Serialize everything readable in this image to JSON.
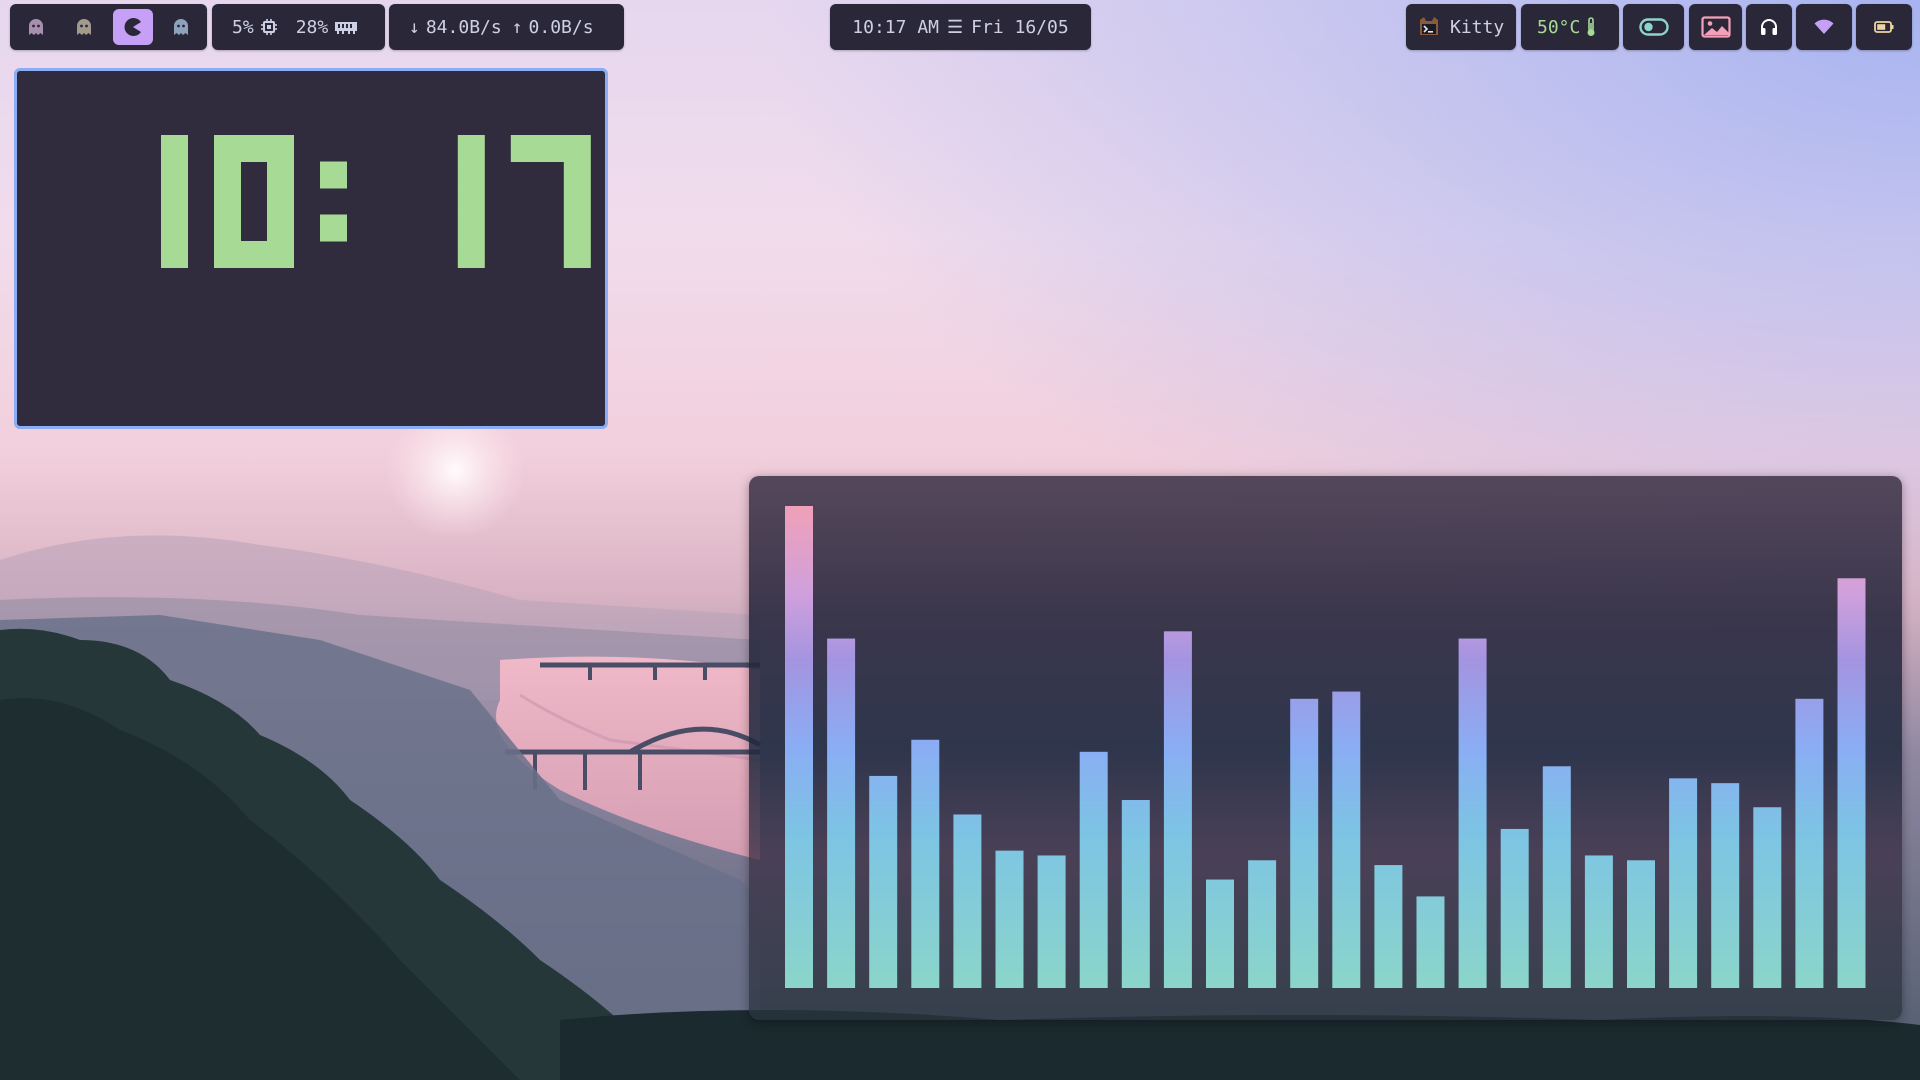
{
  "topbar": {
    "workspaces": [
      {
        "icon": "ghost-icon",
        "active": false
      },
      {
        "icon": "ghost-icon",
        "active": false
      },
      {
        "icon": "pacman-icon",
        "active": true
      },
      {
        "icon": "ghost-icon",
        "active": false
      }
    ],
    "cpu": "5%",
    "cpu_icon": "cpu-chip-icon",
    "ram": "28%",
    "ram_icon": "ram-icon",
    "net_down": "84.0B/s",
    "net_up": "0.0B/s",
    "clock_time": "10:17 AM",
    "clock_sep": "☰",
    "clock_date": "Fri 16/05",
    "app_name": "Kitty",
    "app_icon": "kitty-cat-icon",
    "temperature": "50°C",
    "temp_icon": "thermometer-icon",
    "toggle_icon": "toggle-on-icon",
    "wallpaper_icon": "image-icon",
    "headphones_icon": "headphones-icon",
    "wifi_icon": "wifi-icon",
    "battery_icon": "battery-icon"
  },
  "clock_widget": {
    "hours": "10",
    "minutes": "17",
    "digit_color": "#a6da95"
  },
  "visualizer": {
    "bars": [
      1.0,
      0.725,
      0.44,
      0.515,
      0.36,
      0.285,
      0.275,
      0.49,
      0.39,
      0.74,
      0.225,
      0.265,
      0.6,
      0.615,
      0.255,
      0.19,
      0.725,
      0.33,
      0.46,
      0.275,
      0.265,
      0.435,
      0.425,
      0.375,
      0.6,
      0.85
    ],
    "gradient": [
      "#f0a0b8",
      "#d0a0dc",
      "#a494e0",
      "#8aadf4",
      "#7dc4e4",
      "#8bd5ca"
    ]
  },
  "colors": {
    "bar_bg": "#2a2838",
    "accent": "#c6a0f6",
    "border": "#8aadf4",
    "green": "#a6da95",
    "teal": "#8bd5ca",
    "pink": "#f5a0b8",
    "yellow": "#eed49f"
  }
}
